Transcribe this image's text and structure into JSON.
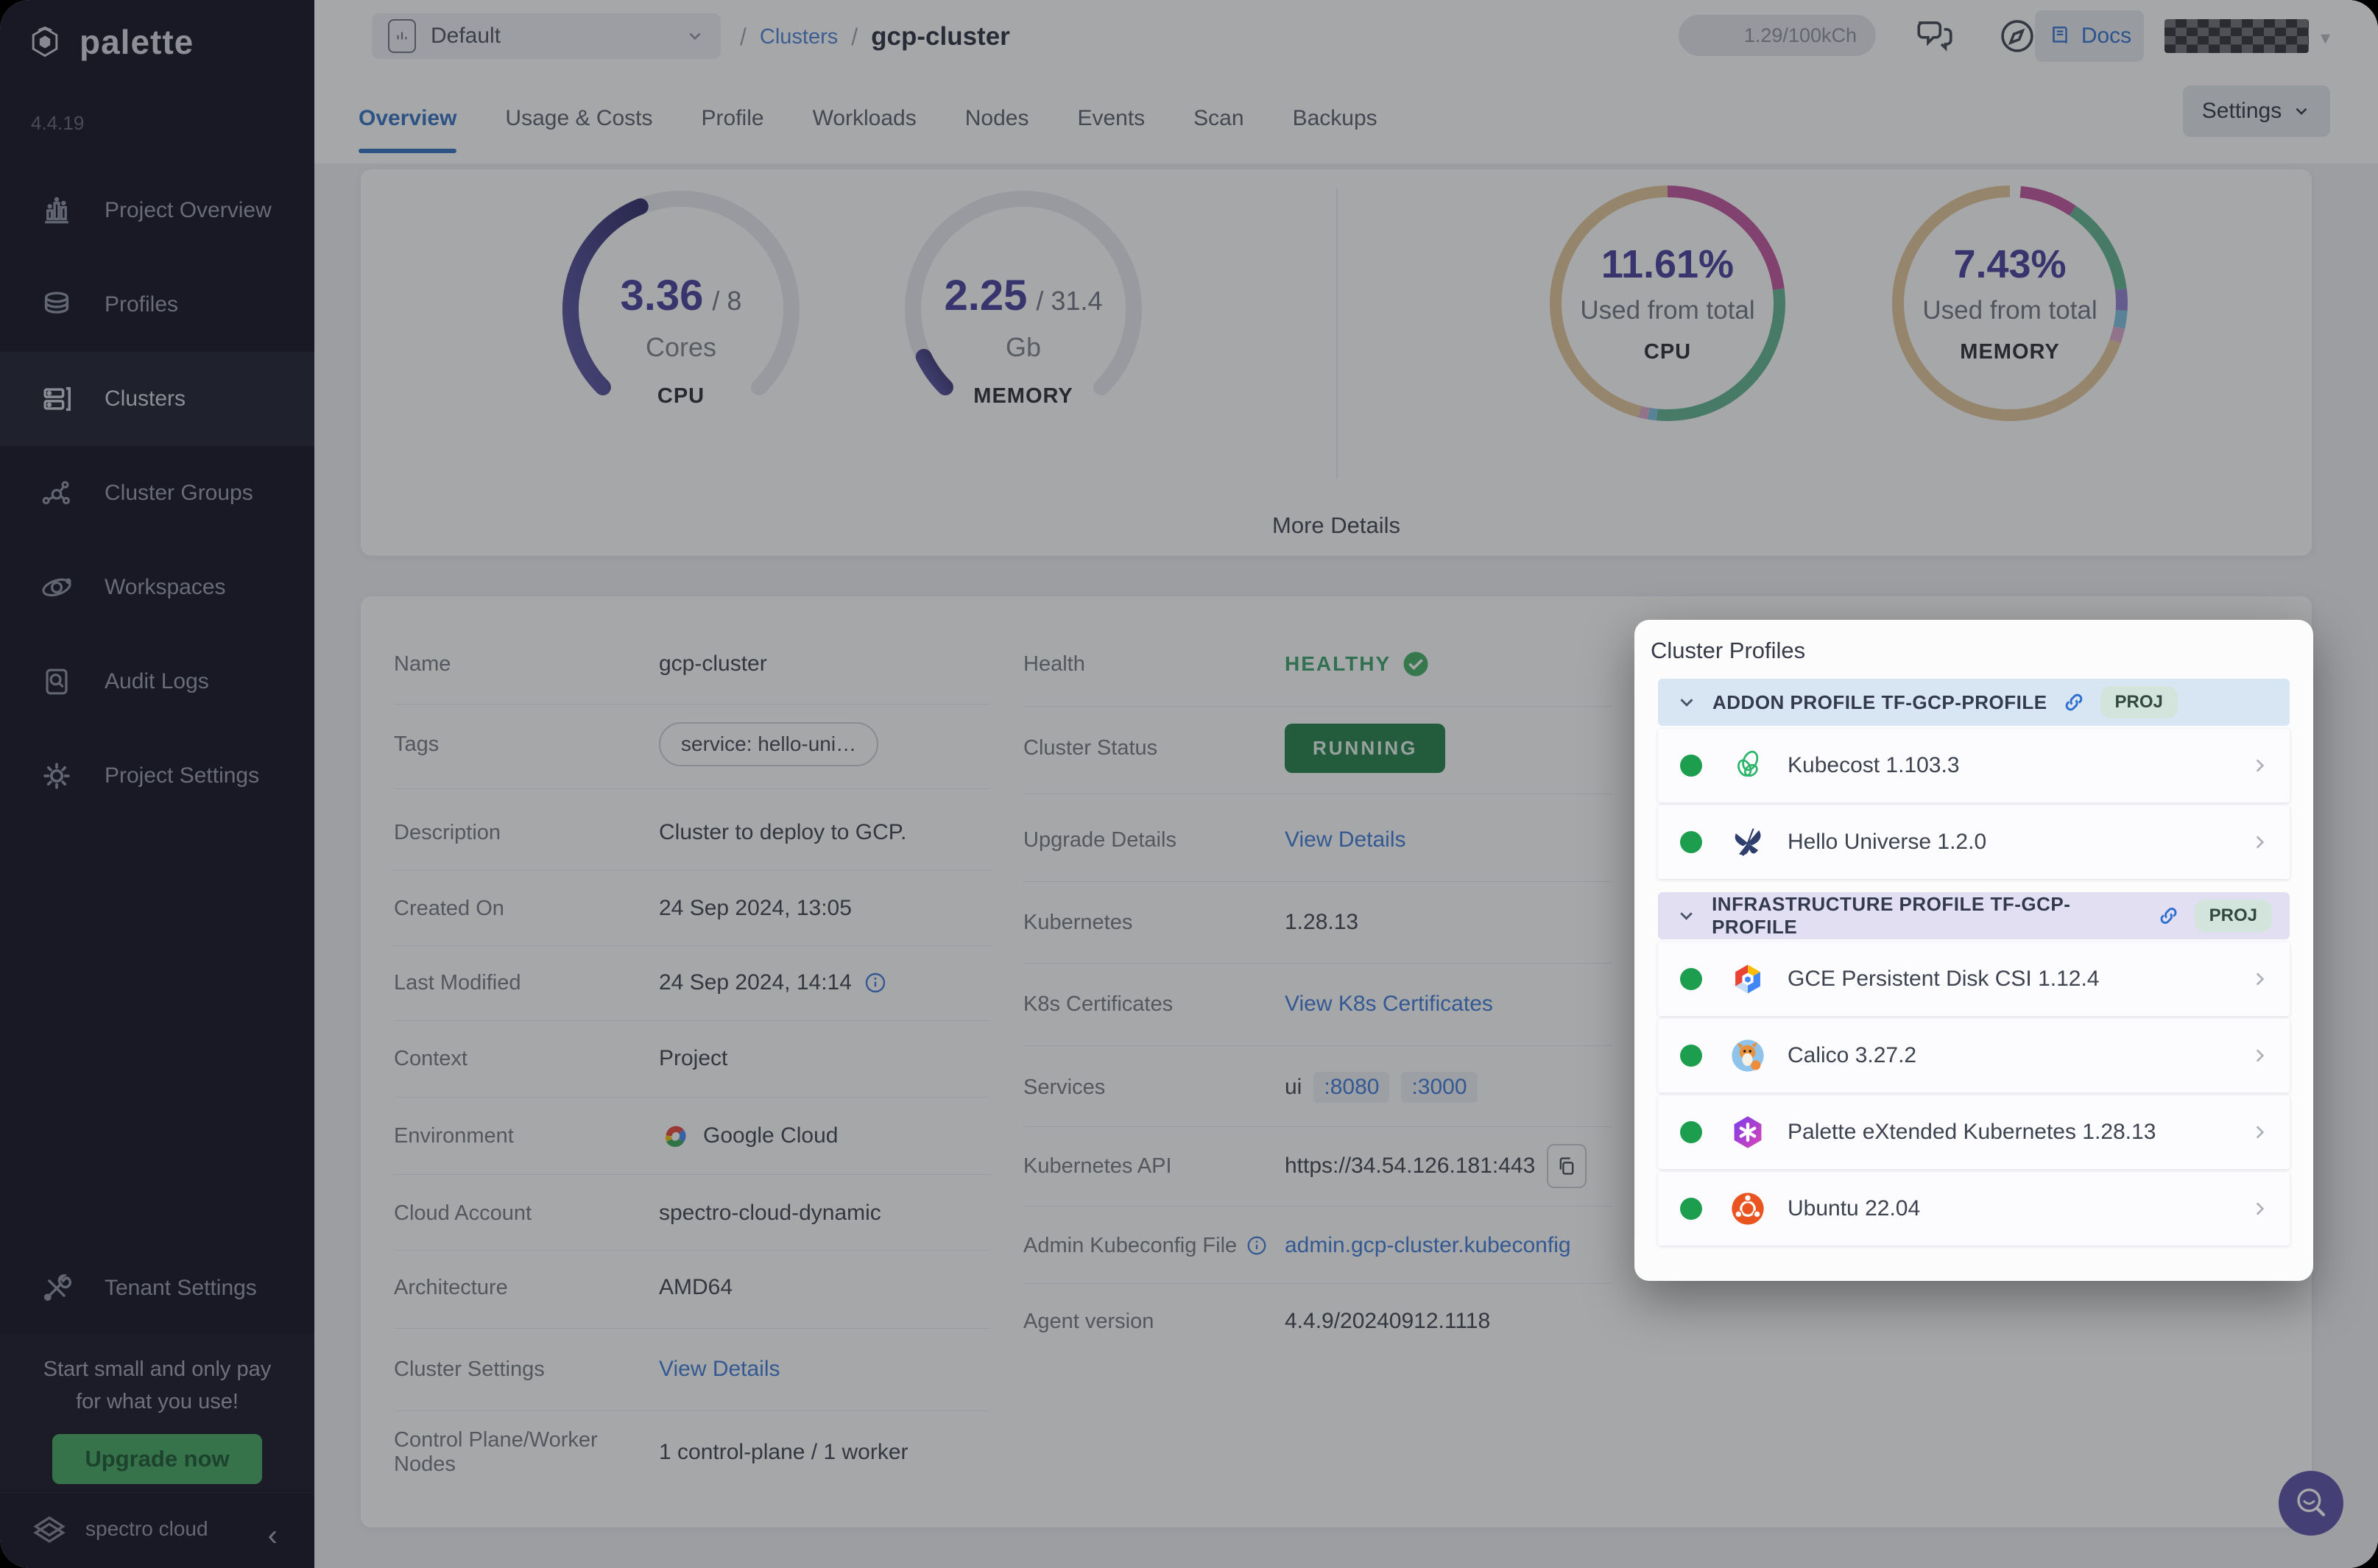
{
  "sidebar": {
    "logo_text": "palette",
    "version": "4.4.19",
    "items": [
      {
        "label": "Project Overview",
        "icon": "bar-chart"
      },
      {
        "label": "Profiles",
        "icon": "layers"
      },
      {
        "label": "Clusters",
        "icon": "servers",
        "active": true
      },
      {
        "label": "Cluster Groups",
        "icon": "network"
      },
      {
        "label": "Workspaces",
        "icon": "orbit"
      },
      {
        "label": "Audit Logs",
        "icon": "audit-doc"
      },
      {
        "label": "Project Settings",
        "icon": "gear"
      },
      {
        "label": "Tenant Settings",
        "icon": "tools"
      }
    ],
    "promo": {
      "line1": "Start small and only pay",
      "line2": "for what you use!",
      "button": "Upgrade now"
    },
    "footer": {
      "brand": "spectro cloud"
    }
  },
  "header": {
    "project_selector": "Default",
    "breadcrumb": {
      "sep1": "/",
      "section": "Clusters",
      "sep2": "/",
      "current": "gcp-cluster"
    },
    "usage_badge": "1.29/100kCh",
    "docs_label": "Docs"
  },
  "tabs": {
    "items": [
      "Overview",
      "Usage & Costs",
      "Profile",
      "Workloads",
      "Nodes",
      "Events",
      "Scan",
      "Backups"
    ],
    "active": "Overview",
    "settings_button": "Settings"
  },
  "overview_card": {
    "more_details": "More Details"
  },
  "chart_data": [
    {
      "id": "cpu-gauge",
      "type": "gauge",
      "arc_degrees": 270,
      "value": 3.36,
      "max": 8,
      "value_label": "3.36",
      "max_label": "/ 8",
      "unit": "Cores",
      "metric": "CPU",
      "color_start": "#2b2766",
      "color_end": "#5b55a6",
      "track": "#e8e8ee"
    },
    {
      "id": "memory-gauge",
      "type": "gauge",
      "arc_degrees": 270,
      "value": 2.25,
      "max": 31.4,
      "value_label": "2.25",
      "max_label": "/ 31.4",
      "unit": "Gb",
      "metric": "MEMORY",
      "color_start": "#2b2766",
      "color_end": "#5b55a6",
      "track": "#e8e8ee"
    },
    {
      "id": "cpu-donut",
      "type": "donut",
      "percent_label": "11.61%",
      "caption": "Used from total",
      "metric": "CPU",
      "segments": [
        {
          "label": "used-magenta",
          "value": 23,
          "color": "#c2519c"
        },
        {
          "label": "used-green",
          "value": 28.5,
          "color": "#5eb38e"
        },
        {
          "label": "sliver-blue",
          "value": 1.2,
          "color": "#7dbfe0"
        },
        {
          "label": "sliver-pink",
          "value": 1.3,
          "color": "#dba7ca"
        },
        {
          "label": "available-tan",
          "value": 46,
          "color": "#e2c596"
        }
      ]
    },
    {
      "id": "memory-donut",
      "type": "donut",
      "percent_label": "7.43%",
      "caption": "Used from total",
      "metric": "MEMORY",
      "segments": [
        {
          "label": "gap",
          "value": 1.5,
          "color": "#ffffff"
        },
        {
          "label": "used-magenta",
          "value": 8,
          "color": "#c2519c"
        },
        {
          "label": "used-green",
          "value": 13.5,
          "color": "#5eb38e"
        },
        {
          "label": "sliver-purple",
          "value": 3,
          "color": "#8f7fd0"
        },
        {
          "label": "sliver-blue",
          "value": 2.5,
          "color": "#7dbfe0"
        },
        {
          "label": "sliver-pink",
          "value": 2,
          "color": "#dba7ca"
        },
        {
          "label": "available-tan",
          "value": 69.5,
          "color": "#e2c596"
        }
      ]
    }
  ],
  "details_left": {
    "name": {
      "label": "Name",
      "value": "gcp-cluster"
    },
    "tags": {
      "label": "Tags",
      "value": "service: hello-uni…"
    },
    "description": {
      "label": "Description",
      "value": "Cluster to deploy to GCP."
    },
    "created_on": {
      "label": "Created On",
      "value": "24 Sep 2024, 13:05"
    },
    "last_modified": {
      "label": "Last Modified",
      "value": "24 Sep 2024, 14:14"
    },
    "context": {
      "label": "Context",
      "value": "Project"
    },
    "environment": {
      "label": "Environment",
      "value": "Google Cloud"
    },
    "cloud_account": {
      "label": "Cloud Account",
      "value": "spectro-cloud-dynamic"
    },
    "architecture": {
      "label": "Architecture",
      "value": "AMD64"
    },
    "cluster_settings": {
      "label": "Cluster Settings",
      "link": "View Details"
    },
    "nodes": {
      "label": "Control Plane/Worker Nodes",
      "value": "1 control-plane / 1 worker"
    }
  },
  "details_right": {
    "health": {
      "label": "Health",
      "value": "HEALTHY"
    },
    "cluster_status": {
      "label": "Cluster Status",
      "value": "RUNNING"
    },
    "upgrade_details": {
      "label": "Upgrade Details",
      "link": "View Details"
    },
    "kubernetes": {
      "label": "Kubernetes",
      "value": "1.28.13"
    },
    "k8s_certificates": {
      "label": "K8s Certificates",
      "link": "View K8s Certificates"
    },
    "services": {
      "label": "Services",
      "prefix": "ui",
      "port1": ":8080",
      "port2": ":3000"
    },
    "kubernetes_api": {
      "label": "Kubernetes API",
      "value": "https://34.54.126.181:443"
    },
    "admin_kubeconfig": {
      "label": "Admin Kubeconfig File",
      "link": "admin.gcp-cluster.kubeconfig"
    },
    "agent_version": {
      "label": "Agent version",
      "value": "4.4.9/20240912.1118"
    }
  },
  "cluster_profiles": {
    "title": "Cluster Profiles",
    "sections": [
      {
        "header": "ADDON PROFILE TF-GCP-PROFILE",
        "badge": "PROJ",
        "items": [
          {
            "name": "Kubecost 1.103.3",
            "logo": "kubecost"
          },
          {
            "name": "Hello Universe 1.2.0",
            "logo": "hello-universe"
          }
        ]
      },
      {
        "header": "INFRASTRUCTURE PROFILE TF-GCP-PROFILE",
        "badge": "PROJ",
        "items": [
          {
            "name": "GCE Persistent Disk CSI 1.12.4",
            "logo": "gce-disk"
          },
          {
            "name": "Calico 3.27.2",
            "logo": "calico"
          },
          {
            "name": "Palette eXtended Kubernetes 1.28.13",
            "logo": "pxk"
          },
          {
            "name": "Ubuntu 22.04",
            "logo": "ubuntu"
          }
        ]
      }
    ]
  }
}
